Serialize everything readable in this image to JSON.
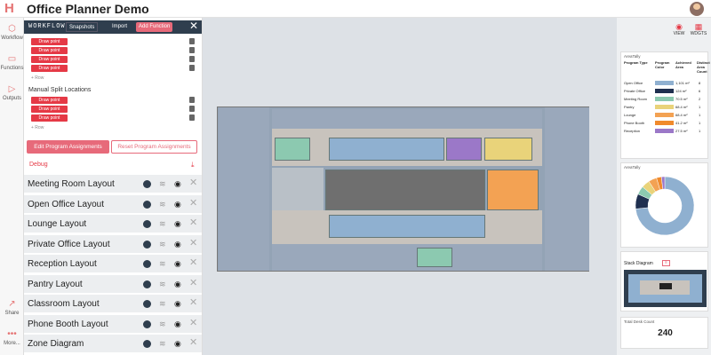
{
  "app": {
    "title": "Office Planner Demo"
  },
  "rail": {
    "items": [
      {
        "label": "Workflow",
        "icon": "workflow-icon"
      },
      {
        "label": "Functions",
        "icon": "functions-icon"
      },
      {
        "label": "Outputs",
        "icon": "outputs-icon"
      },
      {
        "label": "Share",
        "icon": "share-icon"
      },
      {
        "label": "More...",
        "icon": "more-icon"
      }
    ]
  },
  "workflow_bar": {
    "title": "WORKFLOW",
    "snapshots": "Snapshots",
    "import": "Import",
    "add_function": "Add Function"
  },
  "draw_point_label": "Draw point",
  "row_label": "+ Row",
  "manual_split_title": "Manual Split Locations",
  "buttons": {
    "edit": "Edit Program Assignments",
    "reset": "Reset Program Assignments"
  },
  "debug_label": "Debug",
  "layouts": [
    {
      "name": "Meeting Room Layout"
    },
    {
      "name": "Open Office Layout"
    },
    {
      "name": "Lounge Layout"
    },
    {
      "name": "Private Office Layout"
    },
    {
      "name": "Reception Layout"
    },
    {
      "name": "Pantry Layout"
    },
    {
      "name": "Classroom Layout"
    },
    {
      "name": "Phone Booth Layout"
    },
    {
      "name": "Zone Diagram"
    }
  ],
  "view_buttons": {
    "view": "VIEW",
    "widgets": "WDGTS"
  },
  "area_tally": {
    "title": "AreaTally",
    "headers": [
      "Program Type",
      "Program Color",
      "Achieved Area",
      "Distinct Area Count"
    ],
    "rows": [
      {
        "type": "Open Office",
        "color": "#8fb0d0",
        "area": "1,101 m²",
        "count": "8"
      },
      {
        "type": "Private Office",
        "color": "#1f2f4f",
        "area": "124 m²",
        "count": "6"
      },
      {
        "type": "Meeting Room",
        "color": "#8cc9b0",
        "area": "70.5 m²",
        "count": "2"
      },
      {
        "type": "Pantry",
        "color": "#e9d37a",
        "area": "68.4 m²",
        "count": "1"
      },
      {
        "type": "Lounge",
        "color": "#f3a253",
        "area": "68.4 m²",
        "count": "1"
      },
      {
        "type": "Phone Booth",
        "color": "#f08a2c",
        "area": "41.2 m²",
        "count": "1"
      },
      {
        "type": "Reception",
        "color": "#9b78c8",
        "area": "27.5 m²",
        "count": "1"
      }
    ]
  },
  "donut": {
    "title": "AreaTally",
    "values": [
      1101,
      124,
      70.5,
      68.4,
      68.4,
      41.2,
      27.5
    ],
    "colors": [
      "#8fb0d0",
      "#1f2f4f",
      "#8cc9b0",
      "#e9d37a",
      "#f3a253",
      "#f08a2c",
      "#9b78c8"
    ]
  },
  "stack": {
    "title": "Stack Diagram",
    "badge": "≡"
  },
  "desk": {
    "title": "Total Desk Count",
    "value": "240"
  }
}
